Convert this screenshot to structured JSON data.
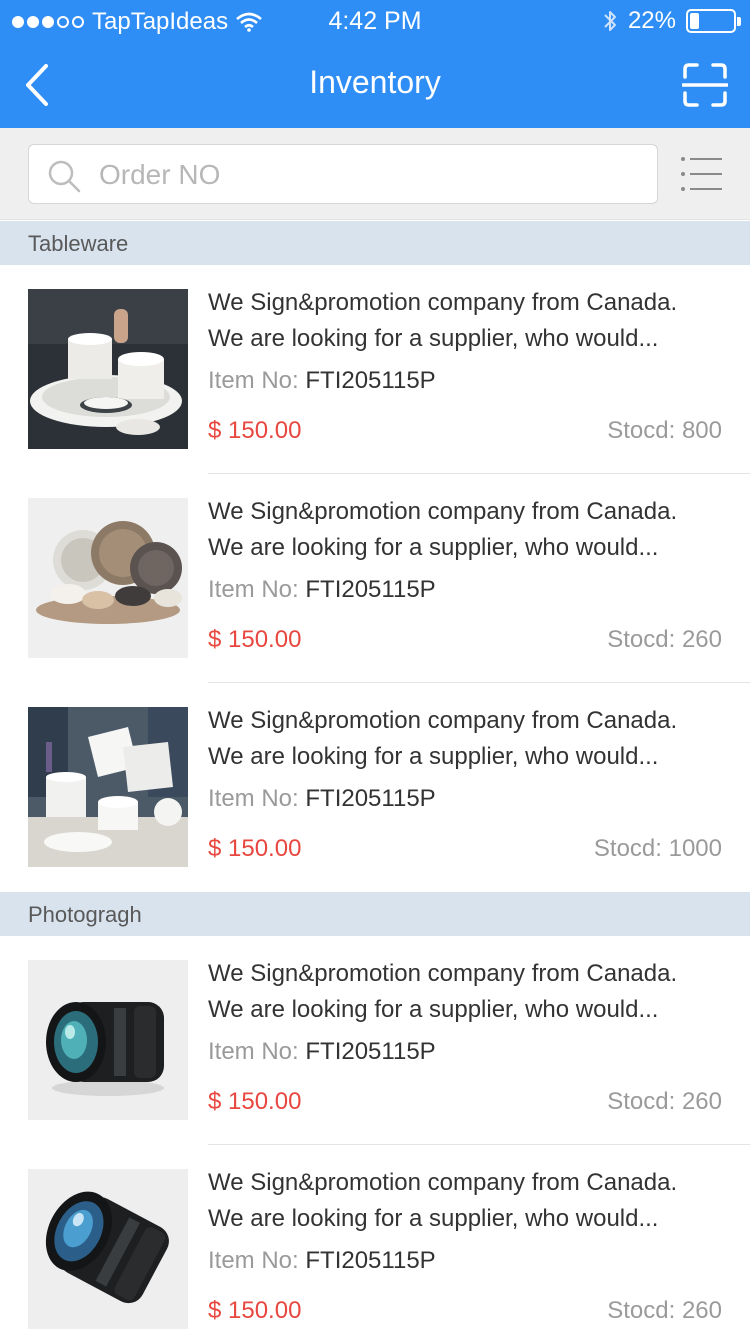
{
  "status_bar": {
    "carrier": "TapTapIdeas",
    "time": "4:42 PM",
    "battery": "22%",
    "battery_level": 0.22
  },
  "nav": {
    "title": "Inventory",
    "back_icon": "chevron-left-icon",
    "scan_icon": "scan-icon"
  },
  "search": {
    "placeholder": "Order NO",
    "value": ""
  },
  "colors": {
    "accent": "#2f8ef6",
    "price": "#e8473f",
    "section_bg": "#d8e3ee"
  },
  "sections": [
    {
      "title": "Tableware",
      "items": [
        {
          "line1": "We Sign&promotion company from Canada.",
          "line2": "We are looking for a supplier, who would...",
          "item_no_label": "Item No:",
          "item_no": "FTI205115P",
          "price": "$ 150.00",
          "stock": "Stocd: 800"
        },
        {
          "line1": "We Sign&promotion company from Canada.",
          "line2": "We are looking for a supplier, who would...",
          "item_no_label": "Item No:",
          "item_no": "FTI205115P",
          "price": "$ 150.00",
          "stock": "Stocd: 260"
        },
        {
          "line1": "We Sign&promotion company from Canada.",
          "line2": "We are looking for a supplier, who would...",
          "item_no_label": "Item No:",
          "item_no": "FTI205115P",
          "price": "$ 150.00",
          "stock": "Stocd: 1000"
        }
      ]
    },
    {
      "title": "Photogragh",
      "items": [
        {
          "line1": "We Sign&promotion company from Canada.",
          "line2": "We are looking for a supplier, who would...",
          "item_no_label": "Item No:",
          "item_no": "FTI205115P",
          "price": "$ 150.00",
          "stock": "Stocd: 260"
        },
        {
          "line1": "We Sign&promotion company from Canada.",
          "line2": "We are looking for a supplier, who would...",
          "item_no_label": "Item No:",
          "item_no": "FTI205115P",
          "price": "$ 150.00",
          "stock": "Stocd: 260"
        }
      ]
    }
  ]
}
